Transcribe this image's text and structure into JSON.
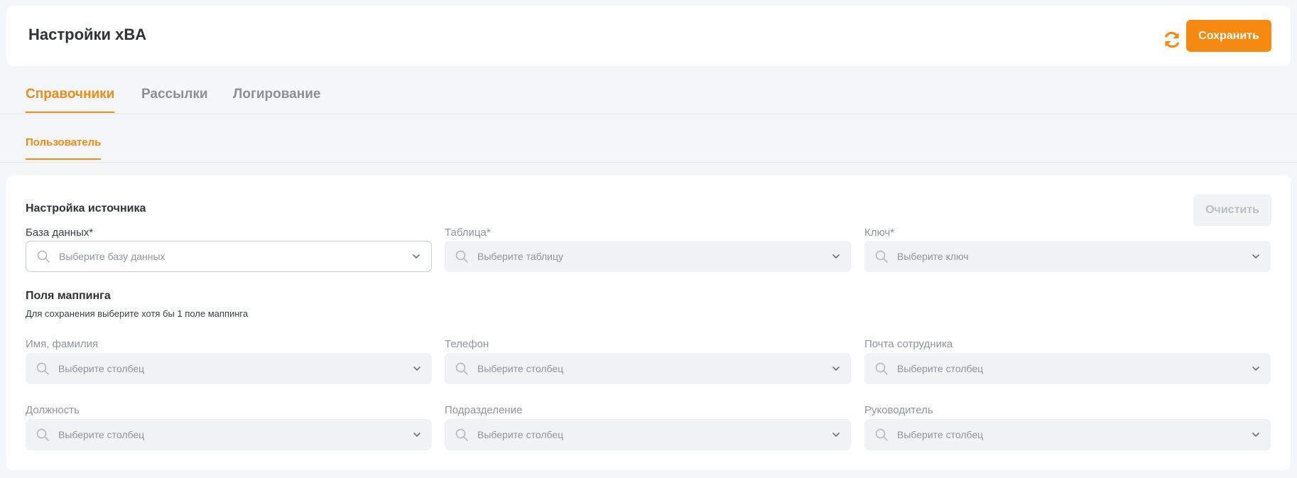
{
  "header": {
    "title": "Настройки xBA",
    "save_label": "Сохранить"
  },
  "tabs": [
    {
      "label": "Справочники",
      "active": true
    },
    {
      "label": "Рассылки",
      "active": false
    },
    {
      "label": "Логирование",
      "active": false
    }
  ],
  "subtab": {
    "label": "Пользователь"
  },
  "source": {
    "title": "Настройка источника",
    "clear_label": "Очистить",
    "database": {
      "label": "База данных*",
      "placeholder": "Выберите базу данных"
    },
    "table": {
      "label": "Таблица*",
      "placeholder": "Выберите таблицу"
    },
    "key": {
      "label": "Ключ*",
      "placeholder": "Выберите ключ"
    }
  },
  "mapping": {
    "title": "Поля маппинга",
    "hint": "Для сохранения выберите хотя бы 1 поле маппинга",
    "fields": [
      {
        "label": "Имя, фамилия",
        "placeholder": "Выберите столбец"
      },
      {
        "label": "Телефон",
        "placeholder": "Выберите столбец"
      },
      {
        "label": "Почта сотрудника",
        "placeholder": "Выберите столбец"
      },
      {
        "label": "Должность",
        "placeholder": "Выберите столбец"
      },
      {
        "label": "Подразделение",
        "placeholder": "Выберите столбец"
      },
      {
        "label": "Руководитель",
        "placeholder": "Выберите столбец"
      }
    ]
  },
  "colors": {
    "accent": "#f6890f",
    "background": "#f5f6f8",
    "card": "#ffffff",
    "field_disabled": "#f1f2f4"
  },
  "icons": [
    "refresh-icon",
    "search-icon",
    "chevron-down-icon"
  ]
}
